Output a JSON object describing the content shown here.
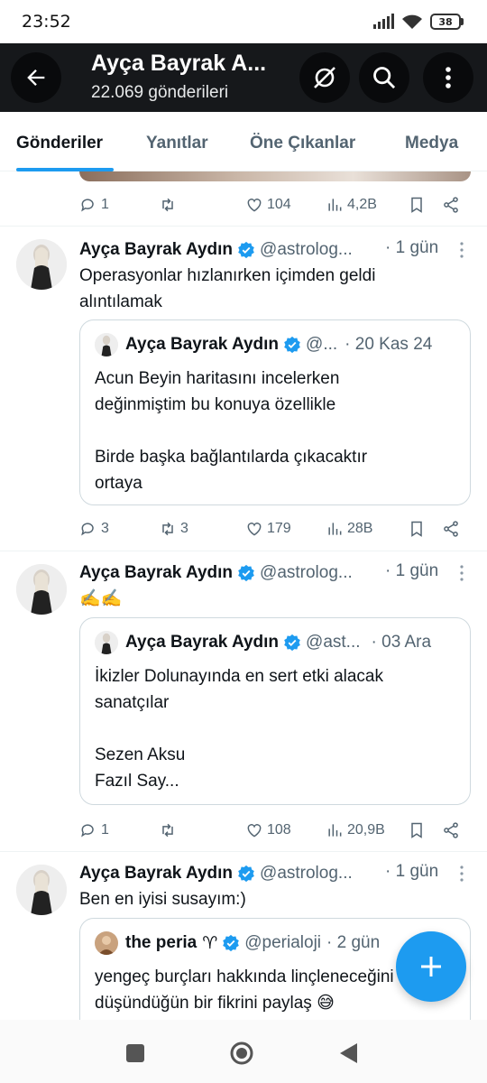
{
  "status_bar": {
    "time": "23:52",
    "battery": "38"
  },
  "header": {
    "title": "Ayça Bayrak A...",
    "subtitle": "22.069 gönderileri"
  },
  "tabs": [
    {
      "label": "Gönderiler",
      "active": true
    },
    {
      "label": "Yanıtlar",
      "active": false
    },
    {
      "label": "Öne Çıkanlar",
      "active": false
    },
    {
      "label": "Medya",
      "active": false
    }
  ],
  "partial_post": {
    "replies": "1",
    "reposts": "",
    "likes": "104",
    "views": "4,2B"
  },
  "posts": [
    {
      "author": "Ayça Bayrak Aydın",
      "handle": "@astrolog...",
      "time": "· 1 gün",
      "text": "Operasyonlar hızlanırken içimden geldi\nalıntılamak",
      "quote": {
        "author": "Ayça Bayrak Aydın",
        "handle": "@...",
        "time": "· 20 Kas 24",
        "text": "Acun Beyin haritasını incelerken\ndeğinmiştim bu konuya özellikle\n\nBirde başka bağlantılarda çıkacaktır\nortaya"
      },
      "replies": "3",
      "reposts": "3",
      "likes": "179",
      "views": "28B"
    },
    {
      "author": "Ayça Bayrak Aydın",
      "handle": "@astrolog...",
      "time": "· 1 gün",
      "text": "✍️✍️",
      "quote": {
        "author": "Ayça Bayrak Aydın",
        "handle": "@ast...",
        "time": "· 03 Ara",
        "text": "İkizler Dolunayında en sert etki alacak\nsanatçılar\n\nSezen Aksu\nFazıl Say..."
      },
      "replies": "1",
      "reposts": "",
      "likes": "108",
      "views": "20,9B"
    },
    {
      "author": "Ayça Bayrak Aydın",
      "handle": "@astrolog...",
      "time": "· 1 gün",
      "text": "Ben en iyisi susayım:)",
      "quote": {
        "author": "the peria",
        "author_symbol": "♈",
        "handle": "@perialoji",
        "time": "· 2 gün",
        "text": "yengeç burçları hakkında linçleneceğini\ndüşündüğün bir fikrini paylaş 😅"
      }
    }
  ],
  "colors": {
    "accent": "#1d9bf0",
    "header_bg": "#16181b",
    "muted": "#536471"
  }
}
